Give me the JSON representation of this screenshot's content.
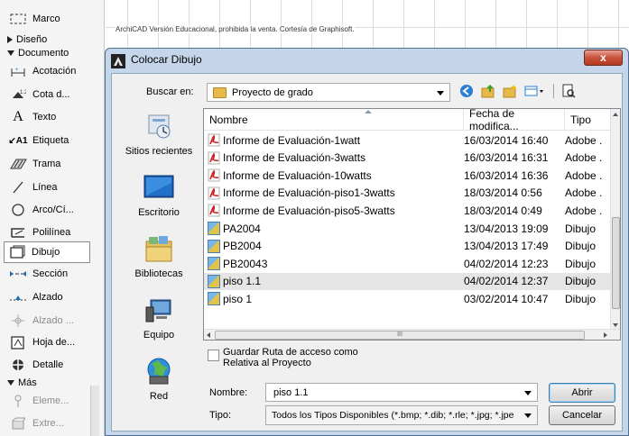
{
  "toolbox": {
    "items": [
      {
        "label": "Marco",
        "icon": "frame-icon"
      },
      {
        "label": "Acotación",
        "icon": "dimension-icon"
      },
      {
        "label": "Cota d...",
        "icon": "level-dimension-icon"
      },
      {
        "label": "Texto",
        "icon": "text-icon"
      },
      {
        "label": "Etiqueta",
        "icon": "label-icon"
      },
      {
        "label": "Trama",
        "icon": "fill-icon"
      },
      {
        "label": "Línea",
        "icon": "line-icon"
      },
      {
        "label": "Arco/Cí...",
        "icon": "arc-icon"
      },
      {
        "label": "Polilínea",
        "icon": "polyline-icon"
      },
      {
        "label": "Dibujo",
        "icon": "drawing-icon"
      },
      {
        "label": "Sección",
        "icon": "section-icon"
      },
      {
        "label": "Alzado",
        "icon": "elevation-icon"
      },
      {
        "label": "Alzado ...",
        "icon": "interior-elevation-icon"
      },
      {
        "label": "Hoja de...",
        "icon": "worksheet-icon"
      },
      {
        "label": "Detalle",
        "icon": "detail-icon"
      },
      {
        "label": "Eleme...",
        "icon": "element-icon"
      },
      {
        "label": "Extre...",
        "icon": "extra-icon"
      }
    ],
    "groups": {
      "diseno": "Diseño",
      "documento": "Documento",
      "mas": "Más"
    },
    "selected": "Dibujo"
  },
  "watermark": "ArchiCAD Versión Educacional, prohibida la venta. Cortesía de Graphisoft.",
  "dialog": {
    "title": "Colocar Dibujo",
    "close_label": "x",
    "lookin_label": "Buscar en:",
    "lookin_value": "Proyecto de grado",
    "places": [
      "Sitios recientes",
      "Escritorio",
      "Bibliotecas",
      "Equipo",
      "Red"
    ],
    "columns": {
      "name": "Nombre",
      "date": "Fecha de modifica...",
      "type": "Tipo"
    },
    "files": [
      {
        "name": "Informe de Evaluación-1watt",
        "date": "16/03/2014 16:40",
        "type": "Adobe .",
        "kind": "pdf"
      },
      {
        "name": "Informe de Evaluación-3watts",
        "date": "16/03/2014 16:31",
        "type": "Adobe .",
        "kind": "pdf"
      },
      {
        "name": "Informe de Evaluación-10watts",
        "date": "16/03/2014 16:36",
        "type": "Adobe .",
        "kind": "pdf"
      },
      {
        "name": "Informe de Evaluación-piso1-3watts",
        "date": "18/03/2014 0:56",
        "type": "Adobe .",
        "kind": "pdf"
      },
      {
        "name": "Informe de Evaluación-piso5-3watts",
        "date": "18/03/2014 0:49",
        "type": "Adobe .",
        "kind": "pdf"
      },
      {
        "name": "PA2004",
        "date": "13/04/2013 19:09",
        "type": "Dibujo",
        "kind": "pln"
      },
      {
        "name": "PB2004",
        "date": "13/04/2013 17:49",
        "type": "Dibujo",
        "kind": "pln"
      },
      {
        "name": "PB20043",
        "date": "04/02/2014 12:23",
        "type": "Dibujo",
        "kind": "pln"
      },
      {
        "name": "piso 1.1",
        "date": "04/02/2014 12:37",
        "type": "Dibujo",
        "kind": "pln",
        "selected": true
      },
      {
        "name": "piso 1",
        "date": "03/02/2014 10:47",
        "type": "Dibujo",
        "kind": "pln"
      }
    ],
    "hscroll_grip": "III",
    "checkbox_label": "Guardar Ruta de acceso como Relativa al Proyecto",
    "checkbox_checked": false,
    "name_label": "Nombre:",
    "name_value": "piso 1.1",
    "type_label": "Tipo:",
    "type_value": "Todos los Tipos Disponibles (*.bmp; *.dib; *.rle; *.jpg; *.jpe",
    "open_label": "Abrir",
    "cancel_label": "Cancelar"
  }
}
